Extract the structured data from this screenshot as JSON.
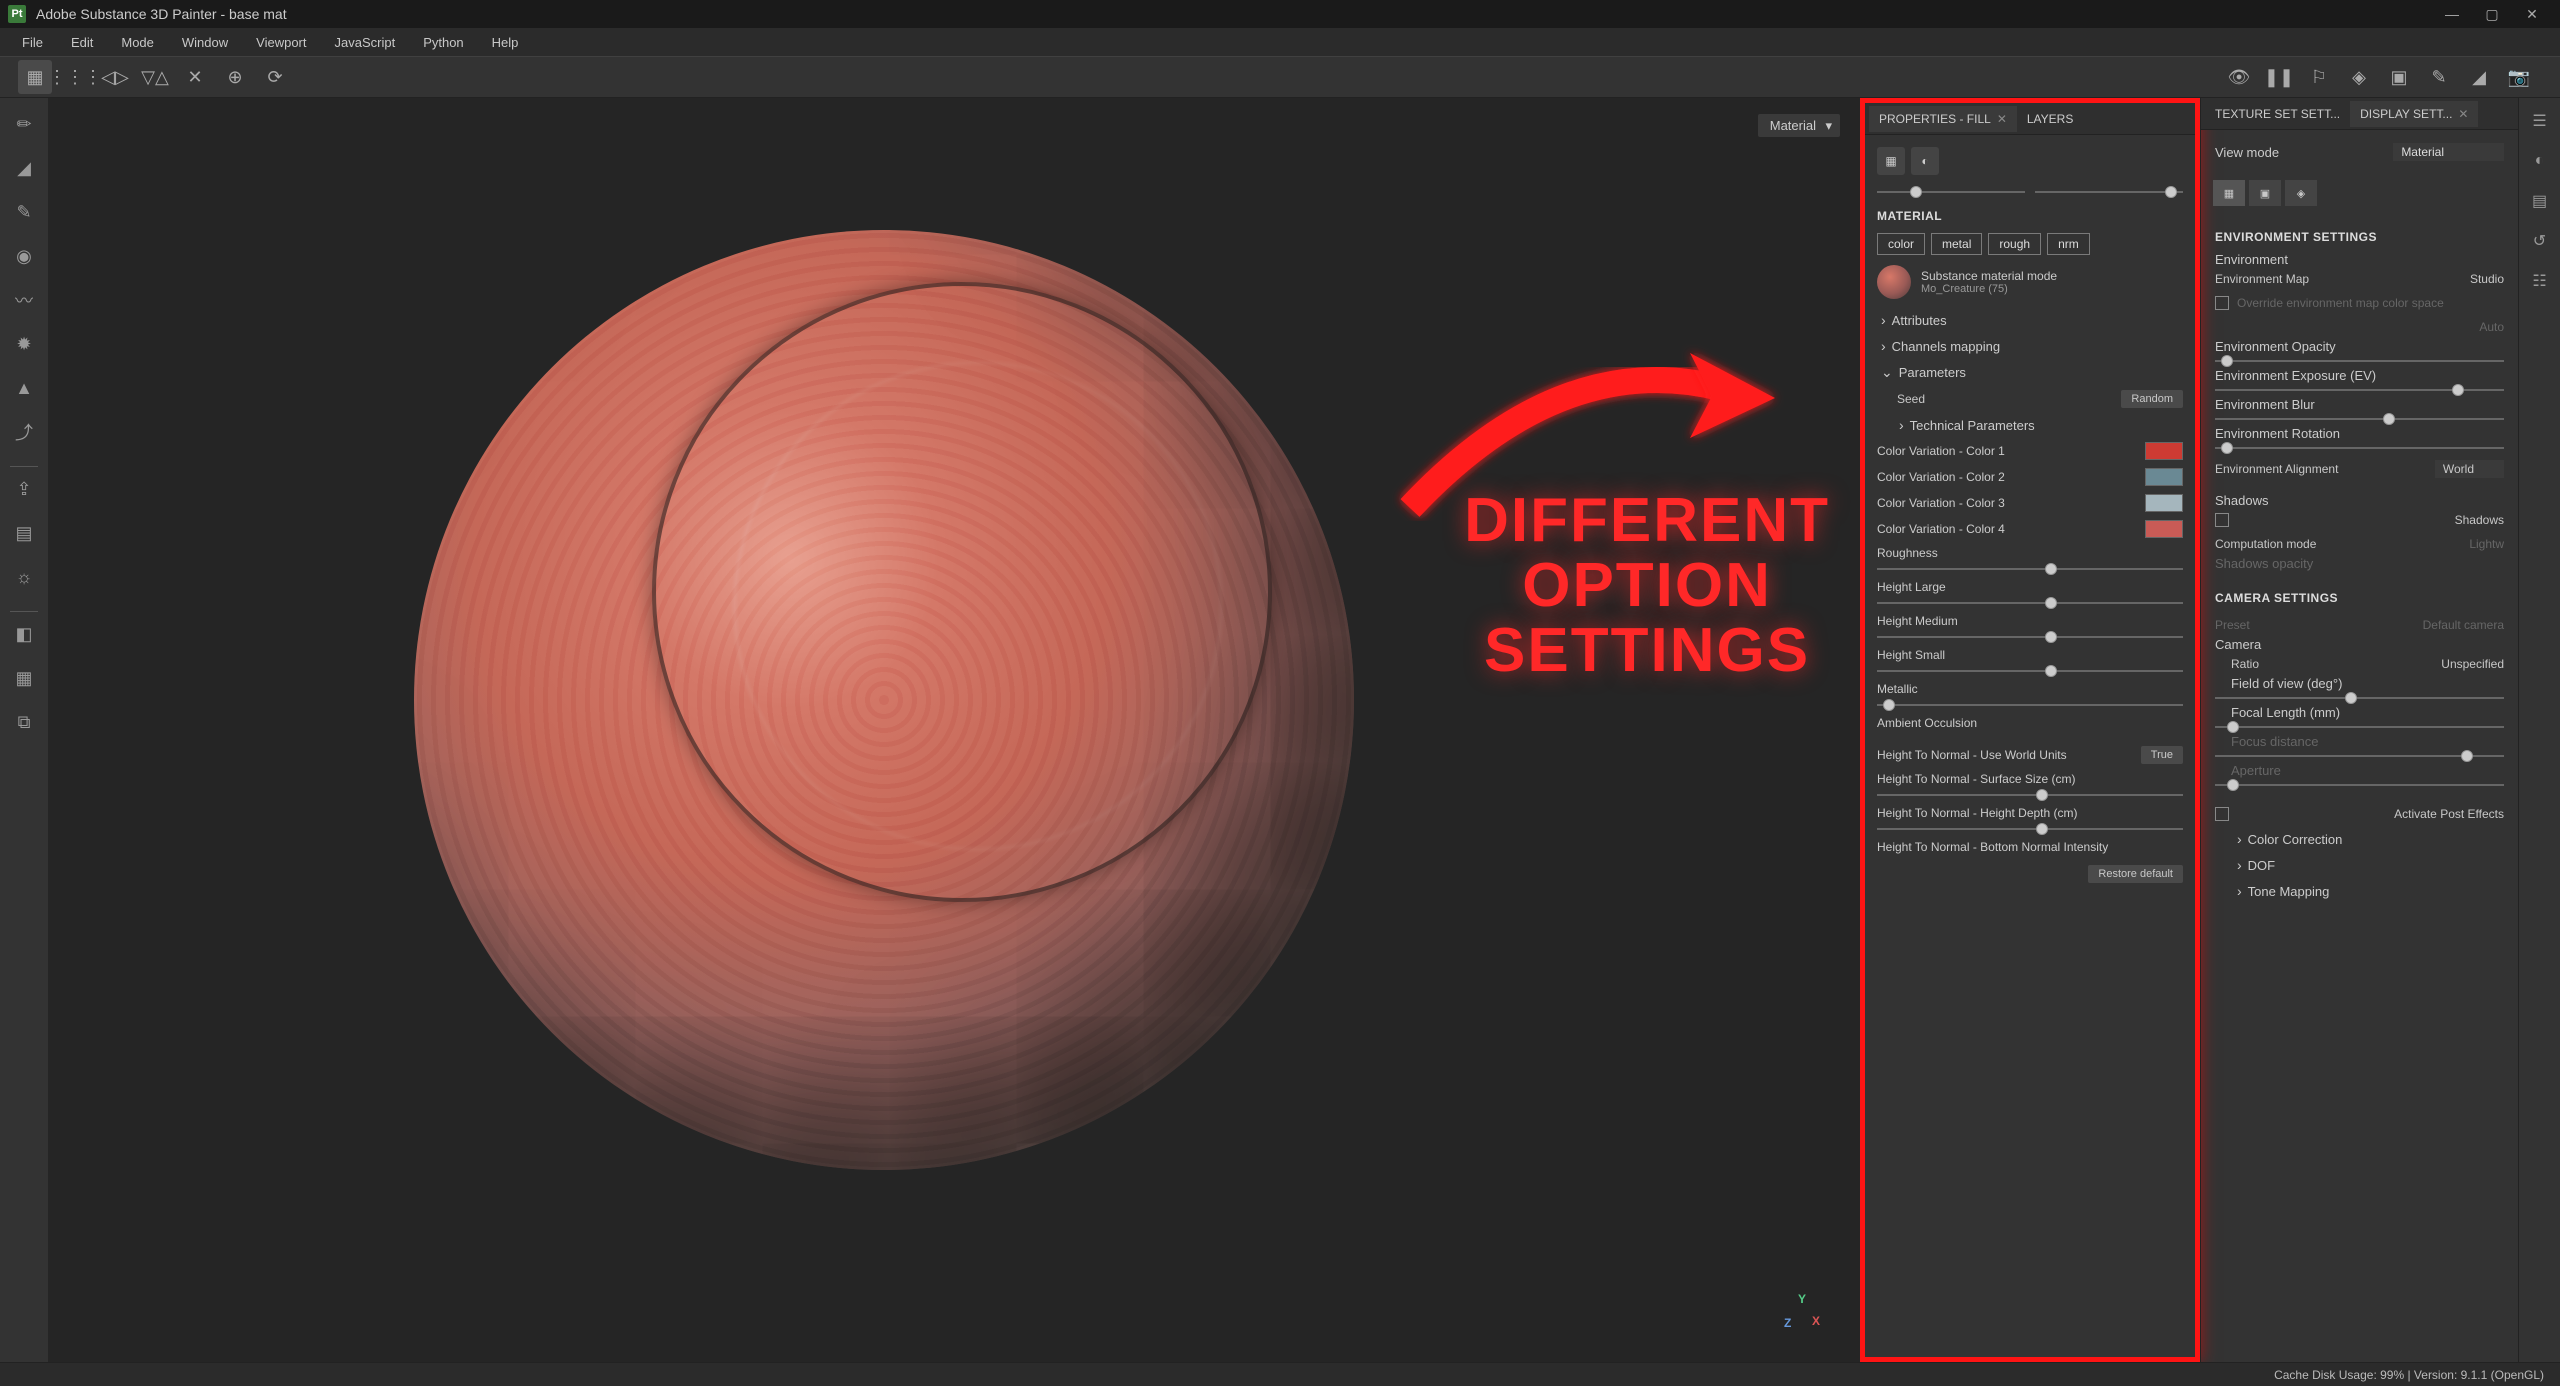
{
  "title": "Adobe Substance 3D Painter - base mat",
  "window_controls": {
    "min": "—",
    "max": "▢",
    "close": "✕"
  },
  "menu": [
    "File",
    "Edit",
    "Mode",
    "Window",
    "Viewport",
    "JavaScript",
    "Python",
    "Help"
  ],
  "viewport": {
    "dropdown": "Material",
    "axes": {
      "x": "X",
      "y": "Y",
      "z": "Z"
    }
  },
  "annotation": "DIFFERENT\nOPTION\nSETTINGS",
  "properties_panel": {
    "tabs": [
      {
        "label": "PROPERTIES - FILL",
        "active": true,
        "closable": true
      },
      {
        "label": "LAYERS",
        "active": false,
        "closable": false
      }
    ],
    "section_material": "MATERIAL",
    "channels": [
      "color",
      "metal",
      "rough",
      "nrm"
    ],
    "material": {
      "title": "Substance material mode",
      "name": "Mo_Creature  (75)"
    },
    "tree": {
      "attributes": "Attributes",
      "channels_mapping": "Channels mapping",
      "parameters": "Parameters",
      "seed_label": "Seed",
      "seed_btn": "Random",
      "tech_params": "Technical Parameters"
    },
    "color_params": [
      {
        "label": "Color Variation - Color 1",
        "color": "#cd3b33"
      },
      {
        "label": "Color Variation - Color 2",
        "color": "#6a8994"
      },
      {
        "label": "Color Variation - Color 3",
        "color": "#a5b6bd"
      },
      {
        "label": "Color Variation - Color 4",
        "color": "#c95b56"
      }
    ],
    "sliders": [
      {
        "label": "Roughness",
        "pos": 55
      },
      {
        "label": "Height Large",
        "pos": 55
      },
      {
        "label": "Height Medium",
        "pos": 55
      },
      {
        "label": "Height Small",
        "pos": 55
      },
      {
        "label": "Metallic",
        "pos": 2
      },
      {
        "label": "Ambient Occulsion",
        "pos": null
      }
    ],
    "normal_params": {
      "use_world": {
        "label": "Height To Normal - Use World Units",
        "val": "True"
      },
      "surface_size": {
        "label": "Height To Normal - Surface Size (cm)",
        "pos": 52
      },
      "height_depth": {
        "label": "Height To Normal - Height Depth (cm)",
        "pos": 52
      },
      "bottom_intensity": {
        "label": "Height To Normal - Bottom Normal Intensity"
      }
    },
    "restore_btn": "Restore default"
  },
  "display_panel": {
    "tabs": [
      {
        "label": "TEXTURE SET SETT...",
        "active": false
      },
      {
        "label": "DISPLAY SETT...",
        "active": true,
        "closable": true
      }
    ],
    "view_mode": {
      "label": "View mode",
      "value": "Material"
    },
    "env_head": "ENVIRONMENT SETTINGS",
    "environment": "Environment",
    "env_map": {
      "label": "Environment Map",
      "value": "Studio"
    },
    "override": "Override environment map color space",
    "auto": "Auto",
    "env_opacity": "Environment Opacity",
    "env_exposure": "Environment Exposure (EV)",
    "env_blur": "Environment Blur",
    "env_rotation": "Environment Rotation",
    "env_alignment": {
      "label": "Environment Alignment",
      "value": "World"
    },
    "shadows_head": "Shadows",
    "shadows_check": "Shadows",
    "computation": {
      "label": "Computation mode",
      "value": "Lightw"
    },
    "shadows_opacity": "Shadows opacity",
    "camera_head": "CAMERA SETTINGS",
    "preset": {
      "label": "Preset",
      "value": "Default camera"
    },
    "camera": "Camera",
    "ratio": {
      "label": "Ratio",
      "value": "Unspecified"
    },
    "fov": "Field of view (deg°)",
    "focal": "Focal Length (mm)",
    "focus": "Focus distance",
    "aperture": "Aperture",
    "post_effects": "Activate Post Effects",
    "sub_effects": [
      "Color Correction",
      "DOF",
      "Tone Mapping"
    ]
  },
  "statusbar": "Cache Disk Usage:  99% | Version: 9.1.1 (OpenGL)"
}
